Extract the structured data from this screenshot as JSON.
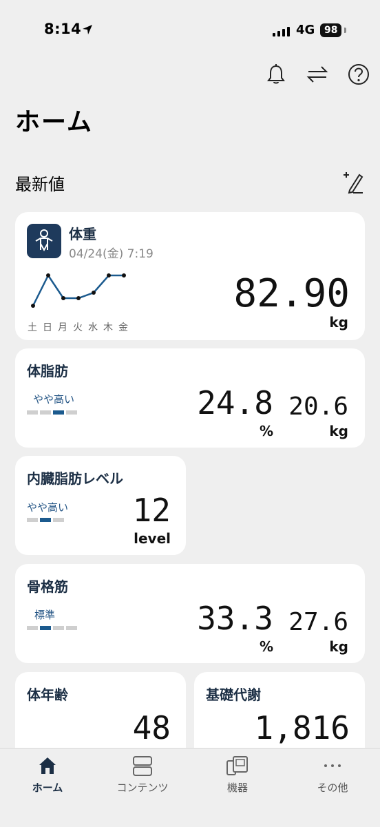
{
  "status_bar": {
    "time": "8:14",
    "network": "4G",
    "battery": "98"
  },
  "header": {
    "title": "ホーム"
  },
  "section": {
    "title": "最新値"
  },
  "weight": {
    "title": "体重",
    "timestamp": "04/24(金) 7:19",
    "value": "82.90",
    "unit": "kg",
    "days": [
      "土",
      "日",
      "月",
      "火",
      "水",
      "木",
      "金"
    ]
  },
  "body_fat": {
    "title": "体脂肪",
    "status": "やや高い",
    "level": 3,
    "levels": 4,
    "percent": "24.8",
    "percent_unit": "%",
    "mass": "20.6",
    "mass_unit": "kg"
  },
  "visceral_fat": {
    "title": "内臓脂肪レベル",
    "status": "やや高い",
    "level": 2,
    "levels": 3,
    "value": "12",
    "unit": "level"
  },
  "skeletal_muscle": {
    "title": "骨格筋",
    "status": "標準",
    "level": 2,
    "levels": 4,
    "percent": "33.3",
    "percent_unit": "%",
    "mass": "27.6",
    "mass_unit": "kg"
  },
  "body_age": {
    "title": "体年齢",
    "value": "48"
  },
  "bmr": {
    "title": "基礎代謝",
    "value": "1,816"
  },
  "tabs": [
    {
      "label": "ホーム",
      "icon": "home-icon",
      "active": true
    },
    {
      "label": "コンテンツ",
      "icon": "contents-icon",
      "active": false
    },
    {
      "label": "機器",
      "icon": "devices-icon",
      "active": false
    },
    {
      "label": "その他",
      "icon": "more-icon",
      "active": false
    }
  ],
  "colors": {
    "accent": "#1b5a8e",
    "title": "#1c2f45",
    "background": "#efefef"
  }
}
